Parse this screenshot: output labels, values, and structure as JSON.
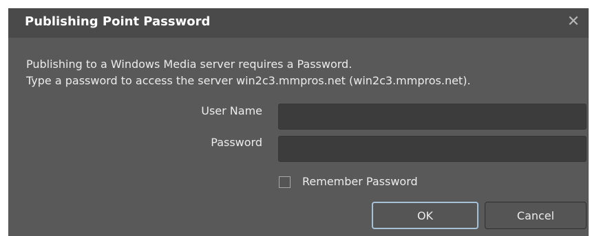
{
  "dialog": {
    "title": "Publishing Point Password",
    "close_glyph": "✕",
    "close_icon": "close-icon",
    "message_line1": "Publishing to a Windows Media server requires a Password.",
    "message_line2": "Type a password to access the server win2c3.mmpros.net (win2c3.mmpros.net).",
    "user_name_label": "User Name",
    "user_name_value": "",
    "password_label": "Password",
    "password_value": "",
    "remember_label": "Remember Password",
    "remember_checked": false,
    "ok_label": "OK",
    "cancel_label": "Cancel"
  },
  "colors": {
    "dialog_background": "#595959",
    "titlebar_background": "#4a4a4a",
    "input_background": "#3c3c3c",
    "default_button_border": "#a5c2d9",
    "text": "#ececec"
  }
}
